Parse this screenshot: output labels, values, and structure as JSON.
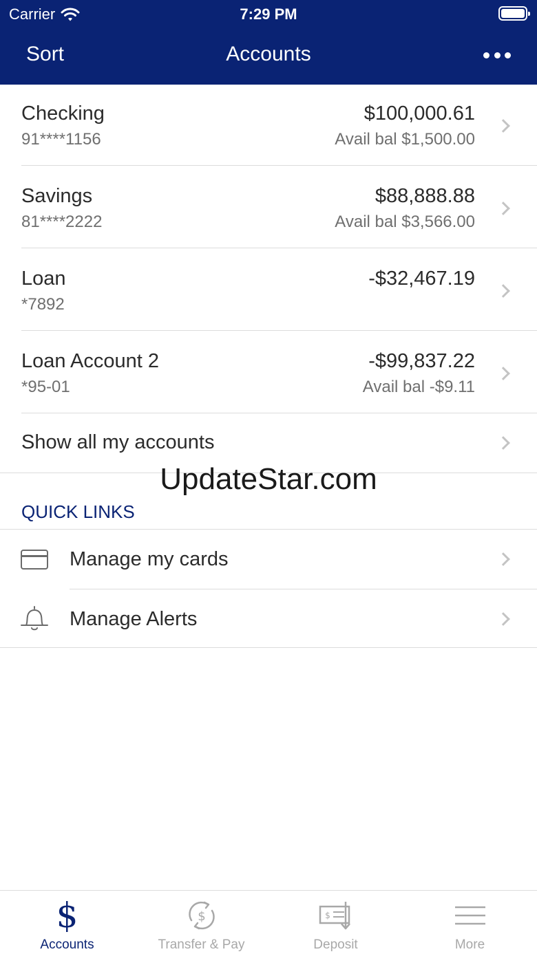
{
  "status_bar": {
    "carrier": "Carrier",
    "time": "7:29 PM"
  },
  "nav": {
    "sort_label": "Sort",
    "title": "Accounts"
  },
  "accounts": [
    {
      "name": "Checking",
      "number": "91****1156",
      "balance": "$100,000.61",
      "avail": "Avail bal $1,500.00"
    },
    {
      "name": "Savings",
      "number": "81****2222",
      "balance": "$88,888.88",
      "avail": "Avail bal $3,566.00"
    },
    {
      "name": "Loan",
      "number": "*7892",
      "balance": "-$32,467.19",
      "avail": ""
    },
    {
      "name": "Loan Account 2",
      "number": "*95-01",
      "balance": "-$99,837.22",
      "avail": "Avail bal -$9.11"
    }
  ],
  "show_all_label": "Show all my accounts",
  "watermark": "UpdateStar.com",
  "quick_links": {
    "header": "QUICK LINKS",
    "items": [
      {
        "label": "Manage my cards",
        "icon": "credit-card-icon"
      },
      {
        "label": "Manage Alerts",
        "icon": "bell-icon"
      }
    ]
  },
  "tabs": [
    {
      "label": "Accounts",
      "icon": "dollar-icon",
      "active": true
    },
    {
      "label": "Transfer & Pay",
      "icon": "transfer-pay-icon",
      "active": false
    },
    {
      "label": "Deposit",
      "icon": "deposit-check-icon",
      "active": false
    },
    {
      "label": "More",
      "icon": "menu-icon",
      "active": false
    }
  ],
  "colors": {
    "brand": "#0a2374",
    "text": "#2b2b2b",
    "secondary": "#6f6f6f",
    "divider": "#dcdcdc",
    "inactive_tab": "#a8a8a8"
  }
}
